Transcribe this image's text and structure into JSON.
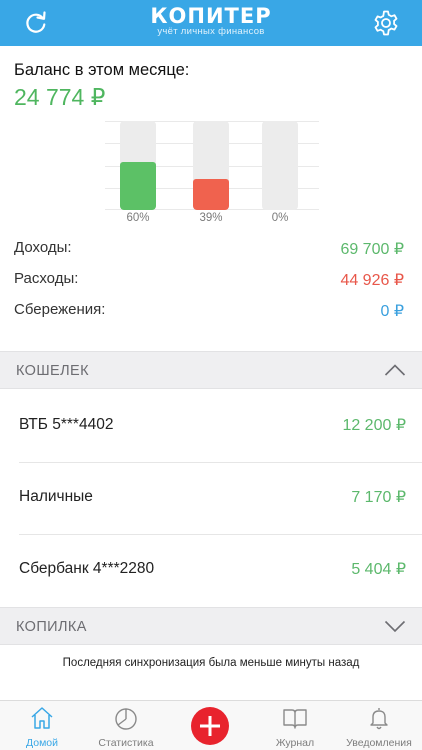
{
  "header": {
    "title": "КОПИТЕР",
    "subtitle": "учёт личных финансов",
    "left_icon": "refresh-icon",
    "right_icon": "gear-icon",
    "color": "#39a7e6"
  },
  "balance": {
    "label": "Баланс в этом месяце:",
    "value": "24 774 ₽",
    "color": "#4fb65f"
  },
  "chart_data": {
    "type": "bar",
    "categories": [
      "",
      "",
      ""
    ],
    "values": [
      60,
      39,
      0
    ],
    "value_labels": [
      "60%",
      "39%",
      "0%"
    ],
    "colors": [
      "#5cc166",
      "#f0624e",
      "#dcdcdc"
    ],
    "ylim": [
      0,
      100
    ],
    "grid": true,
    "title": "",
    "xlabel": "",
    "ylabel": ""
  },
  "stats": [
    {
      "label": "Доходы:",
      "value": "69 700 ₽",
      "color": "#5cb86c"
    },
    {
      "label": "Расходы:",
      "value": "44 926 ₽",
      "color": "#e8574a"
    },
    {
      "label": "Сбережения:",
      "value": "0 ₽",
      "color": "#3aa0de"
    }
  ],
  "wallet": {
    "title": "КОШЕЛЕК",
    "chevron": "chevron-up-icon",
    "items": [
      {
        "name": "ВТБ 5***4402",
        "amount": "12 200 ₽"
      },
      {
        "name": "Наличные",
        "amount": "7 170 ₽"
      },
      {
        "name": "Сбербанк 4***2280",
        "amount": "5 404 ₽"
      }
    ]
  },
  "piggy": {
    "title": "КОПИЛКА",
    "chevron": "chevron-down-icon"
  },
  "sync_text": "Последняя синхронизация была меньше минуты назад",
  "tabbar": {
    "tabs": [
      {
        "label": "Домой",
        "icon": "home-icon",
        "active": true
      },
      {
        "label": "Статистика",
        "icon": "pie-chart-icon",
        "active": false
      },
      {
        "label": "Журнал",
        "icon": "book-icon",
        "active": false
      },
      {
        "label": "Уведомления",
        "icon": "bell-icon",
        "active": false
      }
    ],
    "add_icon": "plus-icon",
    "add_color": "#e8232d"
  }
}
